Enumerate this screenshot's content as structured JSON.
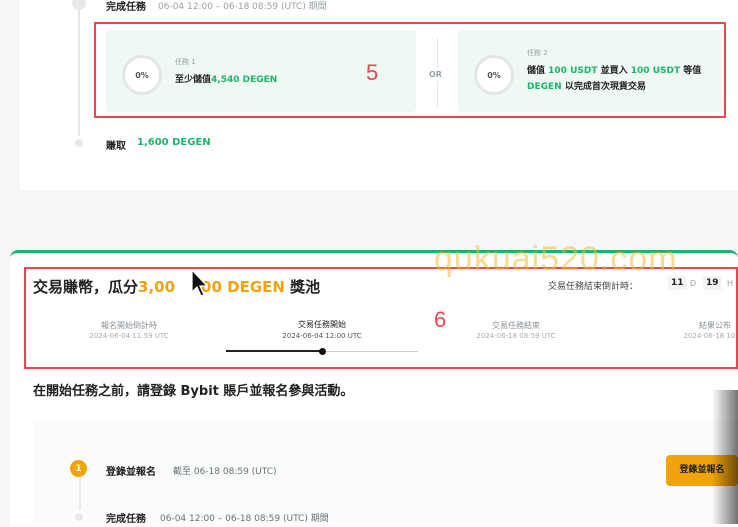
{
  "top_section": {
    "complete_task_label": "完成任務",
    "complete_task_time": "06-04 12:00 – 06-18 08:59 (UTC) 期間",
    "task1": {
      "progress": "0%",
      "title": "任務 1",
      "text_prefix": "至少儲值",
      "text_highlight": "4,540 DEGEN"
    },
    "or_label": "OR",
    "task2": {
      "progress": "0%",
      "title": "任務 2",
      "text_part1": "儲值",
      "text_hl1": "100 USDT",
      "text_part2": "並買入",
      "text_hl2": "100 USDT",
      "text_part3": "等值",
      "text_hl3": "DEGEN",
      "text_part4": "以完成首次現貨交易"
    },
    "earn_label": "賺取",
    "earn_amount": "1,600 DEGEN",
    "annotation": "5"
  },
  "trade_section": {
    "title_prefix": "交易賺幣，瓜分",
    "title_amount_visible_left": "3,00",
    "title_amount_visible_right": "00 DEGEN",
    "title_suffix": "獎池",
    "countdown_label": "交易任務結束倒計時：",
    "countdown_days": "11",
    "countdown_d_unit": "D",
    "countdown_hours": "19",
    "countdown_h_unit": "H",
    "annotation": "6",
    "timeline": [
      {
        "label": "報名開始倒計時",
        "date": "2024-06-04 11:59 UTC",
        "active": false
      },
      {
        "label": "交易任務開始",
        "date": "2024-06-04 12:00 UTC",
        "active": true
      },
      {
        "label": "交易任務結束",
        "date": "2024-06-18 08:59 UTC",
        "active": false
      },
      {
        "label": "結果公布",
        "date": "2024-06-18 10:00",
        "active": false
      }
    ],
    "intro_text": "在開始任務之前，請登錄 Bybit 賬戶並報名參與活動。"
  },
  "bottom_section": {
    "step1_number": "1",
    "register_label": "登錄並報名",
    "register_deadline": "截至 06-18 08:59 (UTC)",
    "register_button": "登錄並報名",
    "complete_task_label": "完成任務",
    "complete_task_time": "06-04 12:00 – 06-18 08:59 (UTC) 期間"
  },
  "watermark": "qukuai520.com",
  "colors": {
    "green": "#20b26c",
    "gold": "#f0a30a",
    "annotation_red": "#e5484d"
  }
}
